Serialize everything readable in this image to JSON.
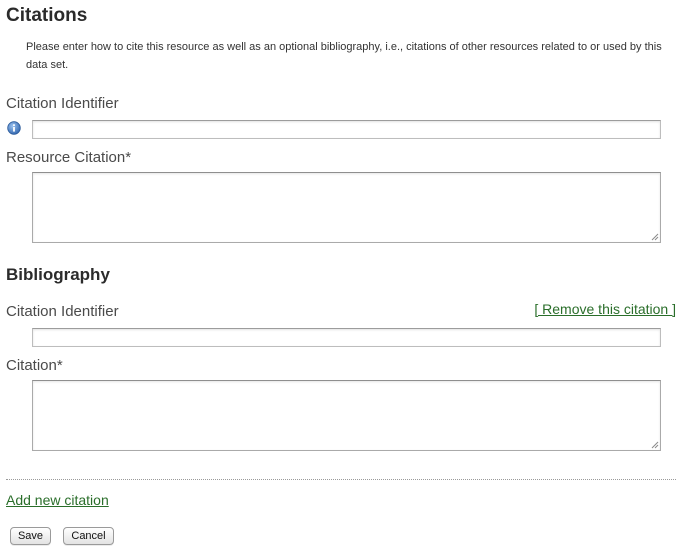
{
  "citations": {
    "title": "Citations",
    "intro": "Please enter how to cite this resource as well as an optional bibliography, i.e., citations of other resources related to or used by this data set.",
    "identifier_label": "Citation Identifier",
    "identifier_value": "",
    "resource_citation_label": "Resource Citation*",
    "resource_citation_value": ""
  },
  "bibliography": {
    "title": "Bibliography",
    "items": [
      {
        "identifier_label": "Citation Identifier",
        "identifier_value": "",
        "remove_label": "[ Remove this citation ]",
        "citation_label": "Citation*",
        "citation_value": ""
      }
    ],
    "add_label": "Add new citation"
  },
  "actions": {
    "save_label": "Save",
    "cancel_label": "Cancel"
  },
  "icons": {
    "info": "info-icon",
    "resize": "resize-grip-icon"
  },
  "colors": {
    "link": "#2a6e2a",
    "info_blue": "#3a6fb5"
  }
}
